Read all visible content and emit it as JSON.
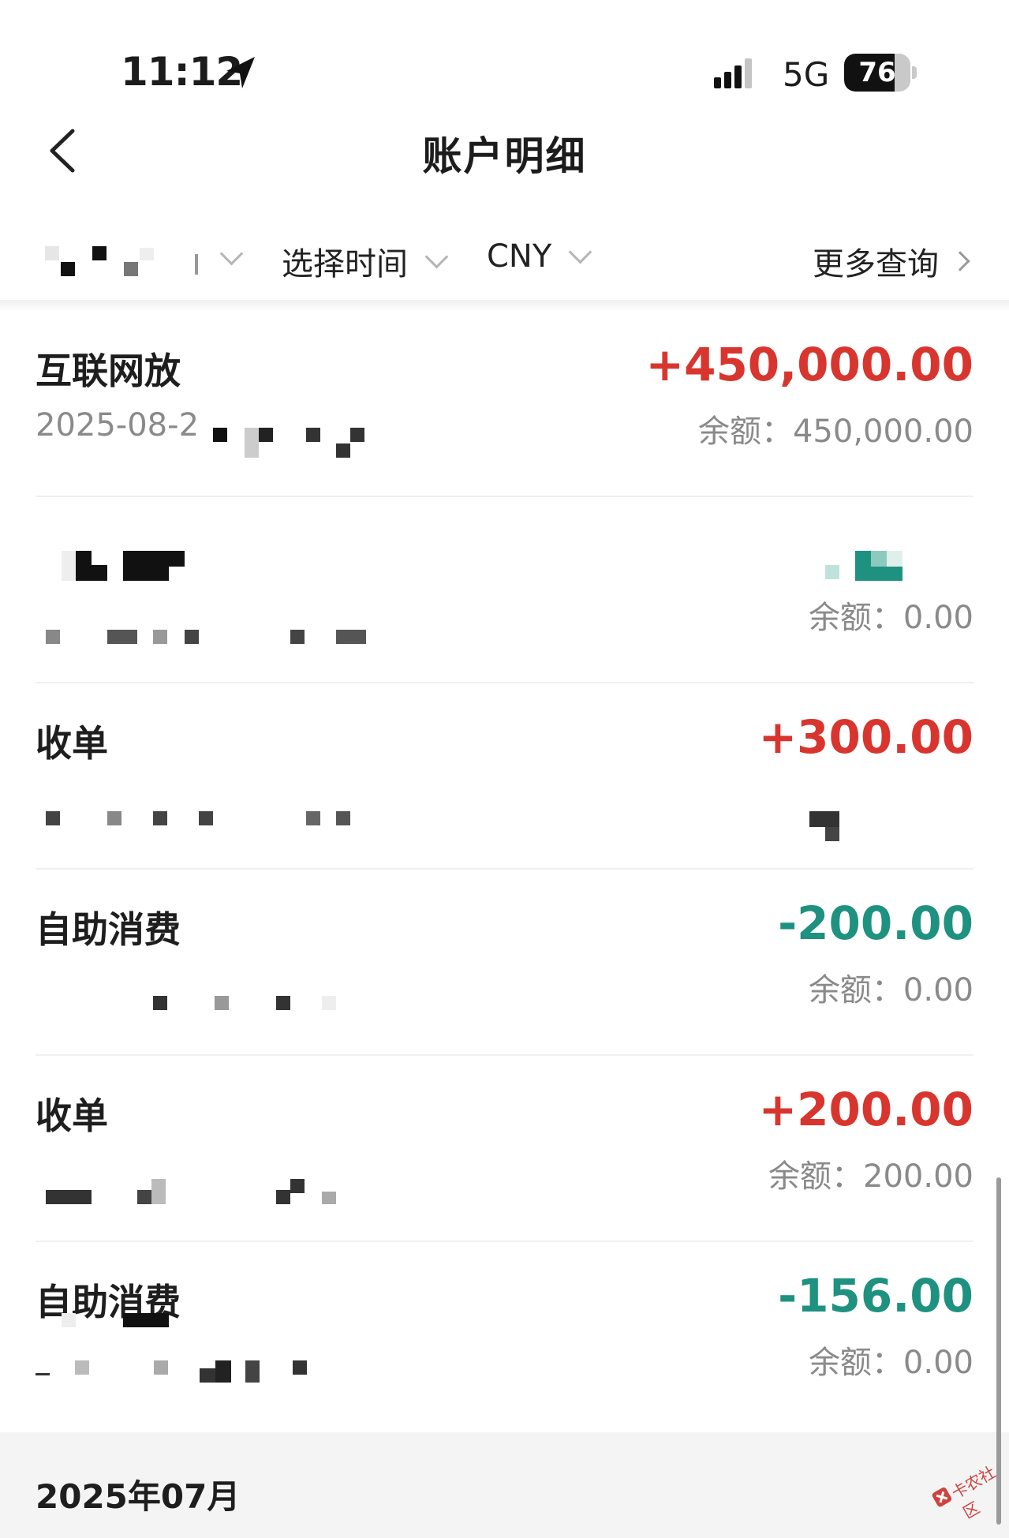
{
  "status_bar": {
    "time": "11:12",
    "network": "5G",
    "battery": "76",
    "battery_level": 0.76
  },
  "header": {
    "title": "账户明细"
  },
  "filters": {
    "time_label": "选择时间",
    "currency_label": "CNY",
    "more_label": "更多查询"
  },
  "transactions": [
    {
      "title": "互联网放",
      "date": "2025-08-2",
      "amount": "+450,000.00",
      "balance": "余额：450,000.00"
    },
    {
      "title": "",
      "date": "",
      "amount": "",
      "balance": "余额：0.00"
    },
    {
      "title": "收单",
      "date": "",
      "amount": "+300.00",
      "balance": ""
    },
    {
      "title": "自助消费",
      "date": "",
      "amount": "-200.00",
      "balance": "余额：0.00"
    },
    {
      "title": "收单",
      "date": "",
      "amount": "+200.00",
      "balance": "余额：200.00"
    },
    {
      "title": "自助消费",
      "date": "",
      "amount": "-156.00",
      "balance": "余额：0.00"
    }
  ],
  "month_header": {
    "label": "2025年07月"
  },
  "watermark": {
    "text": "卡农社区"
  },
  "colors": {
    "income": "#d9352f",
    "expense": "#1f9180"
  }
}
